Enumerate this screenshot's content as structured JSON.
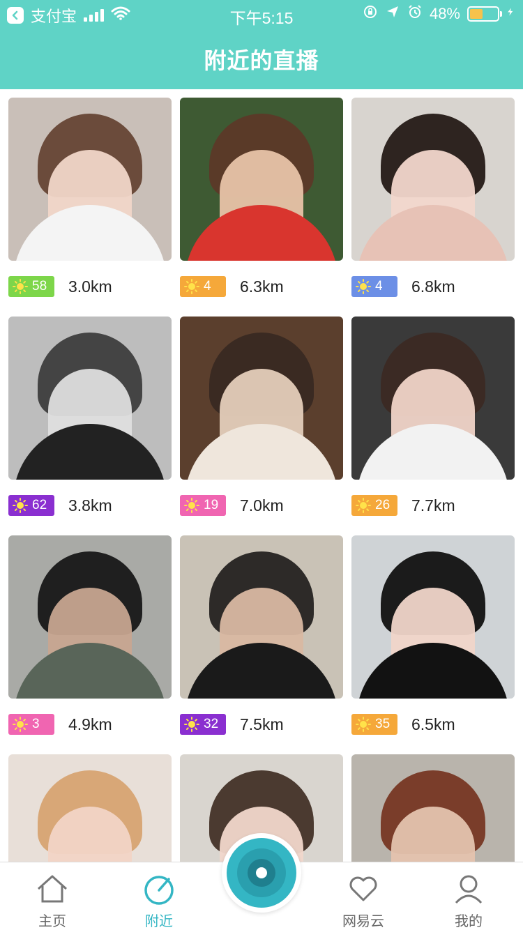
{
  "status_bar": {
    "carrier": "支付宝",
    "time": "下午5:15",
    "battery": "48%",
    "battery_level": 0.48
  },
  "header": {
    "title": "附近的直播"
  },
  "colors": {
    "header_bg": "#5fd3c6",
    "accent": "#34b6c4",
    "badge_green": "#7dd64a",
    "badge_orange": "#f5a83a",
    "badge_blue": "#6c8fe6",
    "badge_purple": "#8a2fd0",
    "badge_pink": "#f065b1"
  },
  "streams": [
    {
      "level": "58",
      "distance": "3.0km",
      "badge_color": "#7dd64a",
      "bg": "#c9bfb8",
      "hair": "#6b4b3b",
      "skin": "#f1d6c8",
      "body": "#f4f4f4"
    },
    {
      "level": "4",
      "distance": "6.3km",
      "badge_color": "#f5a83a",
      "bg": "#3e5a33",
      "hair": "#5a3a28",
      "skin": "#e8c3a8",
      "body": "#d9352e"
    },
    {
      "level": "4",
      "distance": "6.8km",
      "badge_color": "#6c8fe6",
      "bg": "#d8d4cf",
      "hair": "#2e2420",
      "skin": "#f2d7cc",
      "body": "#e7c2b6"
    },
    {
      "level": "62",
      "distance": "3.8km",
      "badge_color": "#8a2fd0",
      "bg": "#bdbdbd",
      "hair": "#444444",
      "skin": "#dedede",
      "body": "#222222"
    },
    {
      "level": "19",
      "distance": "7.0km",
      "badge_color": "#f065b1",
      "bg": "#5b3f2d",
      "hair": "#3a2a22",
      "skin": "#e4cdbb",
      "body": "#efe6dc"
    },
    {
      "level": "26",
      "distance": "7.7km",
      "badge_color": "#f5a83a",
      "bg": "#3a3a3a",
      "hair": "#3b2a24",
      "skin": "#f0d4c8",
      "body": "#f2f2f2"
    },
    {
      "level": "3",
      "distance": "4.9km",
      "badge_color": "#f065b1",
      "bg": "#a9aaa6",
      "hair": "#1f1f1f",
      "skin": "#c7a590",
      "body": "#596559"
    },
    {
      "level": "32",
      "distance": "7.5km",
      "badge_color": "#8a2fd0",
      "bg": "#c9c2b6",
      "hair": "#2d2a28",
      "skin": "#d9b8a2",
      "body": "#1a1a1a"
    },
    {
      "level": "35",
      "distance": "6.5km",
      "badge_color": "#f5a83a",
      "bg": "#cfd3d6",
      "hair": "#1b1b1b",
      "skin": "#f0d5c9",
      "body": "#121212"
    },
    {
      "level": "",
      "distance": "",
      "badge_color": "#f065b1",
      "bg": "#e8dfd8",
      "hair": "#d8a777",
      "skin": "#f2d4c6",
      "body": "#f0e8e2"
    },
    {
      "level": "",
      "distance": "",
      "badge_color": "#f065b1",
      "bg": "#d9d5cf",
      "hair": "#4b3a30",
      "skin": "#f1d7cb",
      "body": "#e9e3dc"
    },
    {
      "level": "",
      "distance": "",
      "badge_color": "#f065b1",
      "bg": "#b9b4ac",
      "hair": "#7a3d2a",
      "skin": "#e4c3ae",
      "body": "#cfc7be"
    }
  ],
  "tabbar": {
    "home": "主页",
    "nearby": "附近",
    "netease": "网易云",
    "mine": "我的"
  }
}
